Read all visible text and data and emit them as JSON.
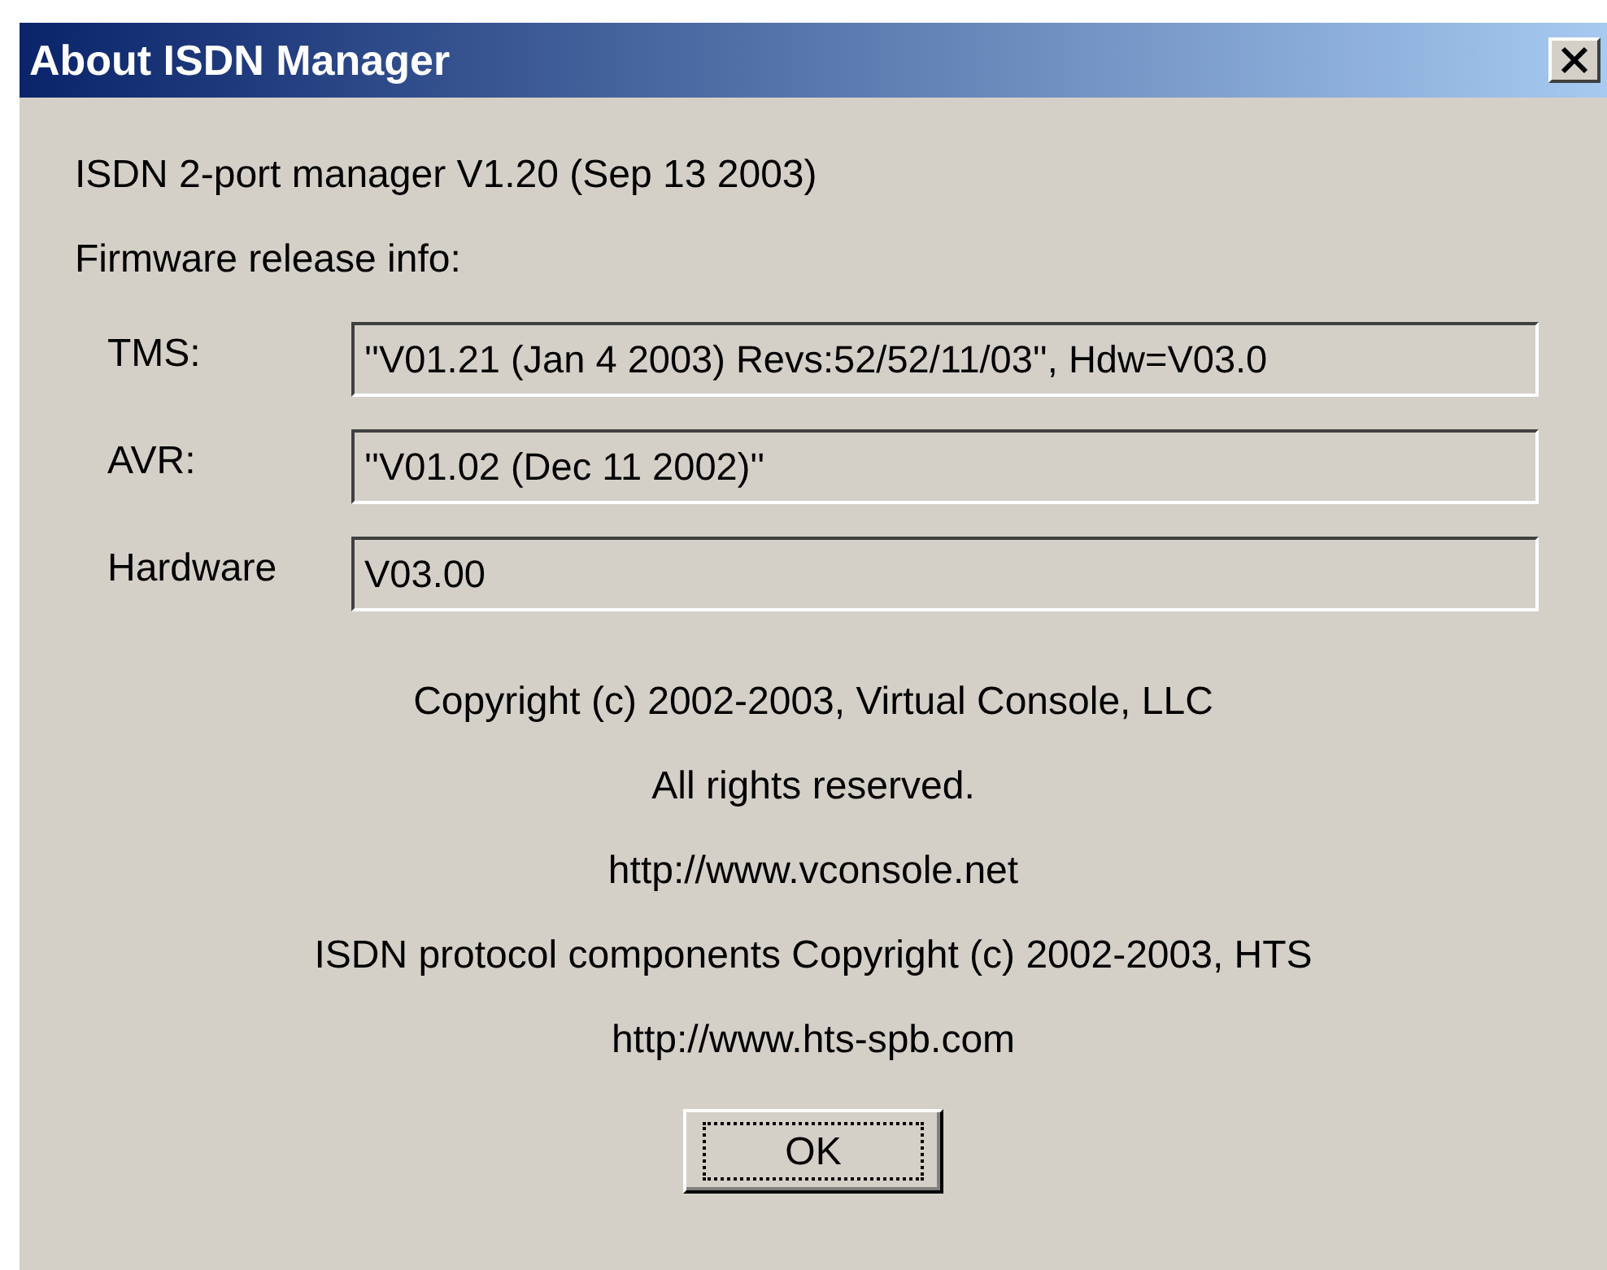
{
  "window": {
    "title": "About ISDN Manager"
  },
  "version_text": "ISDN 2-port manager V1.20  (Sep 13 2003)",
  "firmware_heading": "Firmware release info:",
  "fields": [
    {
      "label": "TMS:",
      "value": "''V01.21 (Jan  4 2003) Revs:52/52/11/03'', Hdw=V03.0"
    },
    {
      "label": "AVR:",
      "value": "''V01.02 (Dec 11 2002)''"
    },
    {
      "label": "Hardware",
      "value": "V03.00"
    }
  ],
  "credits": [
    "Copyright (c) 2002-2003, Virtual Console, LLC",
    "All rights reserved.",
    "http://www.vconsole.net",
    "ISDN protocol components Copyright (c) 2002-2003, HTS",
    "http://www.hts-spb.com"
  ],
  "buttons": [
    {
      "label": "OK"
    }
  ]
}
